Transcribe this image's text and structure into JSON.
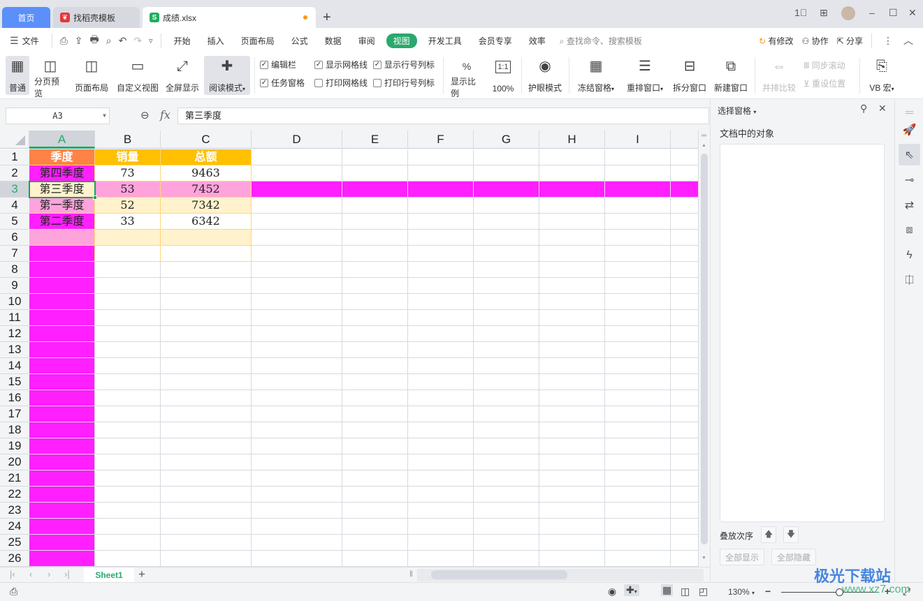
{
  "titlebar": {
    "tabs": [
      {
        "label": "首页",
        "icon": "home"
      },
      {
        "label": "找稻壳模板",
        "icon": "docer-icon"
      },
      {
        "label": "成绩.xlsx",
        "icon": "spreadsheet-icon",
        "icon_glyph": "S",
        "modified": true
      }
    ],
    "add_tab": "+",
    "window_buttons": {
      "layout": "1⃞",
      "apps": "⊞",
      "minimize": "–",
      "maximize": "☐",
      "close": "✕"
    }
  },
  "menubar": {
    "file_label": "文件",
    "menu_icon": "☰",
    "quick": [
      "⎙",
      "⇪",
      "🖶",
      "⌕",
      "↶",
      "↷",
      "▿"
    ],
    "items": [
      "开始",
      "插入",
      "页面布局",
      "公式",
      "数据",
      "审阅",
      "视图",
      "开发工具",
      "会员专享",
      "效率"
    ],
    "active_item": "视图",
    "search_placeholder": "查找命令、搜索模板",
    "right": {
      "changes": "有修改",
      "collab": "协作",
      "share": "分享"
    }
  },
  "ribbon": {
    "views": [
      {
        "label": "普通",
        "icon": "▦",
        "selected": true
      },
      {
        "label": "分页预览",
        "icon": "◫"
      },
      {
        "label": "页面布局",
        "icon": "◫"
      },
      {
        "label": "自定义视图",
        "icon": "▭"
      },
      {
        "label": "全屏显示",
        "icon": "⤢"
      },
      {
        "label": "阅读模式",
        "icon": "✚",
        "dropdown": true,
        "selected": true
      }
    ],
    "checkboxes": [
      {
        "label": "编辑栏",
        "checked": true
      },
      {
        "label": "显示网格线",
        "checked": true
      },
      {
        "label": "显示行号列标",
        "checked": true
      },
      {
        "label": "任务窗格",
        "checked": true
      },
      {
        "label": "打印网格线",
        "checked": false
      },
      {
        "label": "打印行号列标",
        "checked": false
      }
    ],
    "zoom": [
      {
        "label": "显示比例",
        "icon": "%"
      },
      {
        "label": "100%",
        "icon": "1:1"
      }
    ],
    "eye": {
      "label": "护眼模式",
      "icon": "◉"
    },
    "window": [
      {
        "label": "冻结窗格",
        "icon": "▦",
        "dropdown": true
      },
      {
        "label": "重排窗口",
        "icon": "☰",
        "dropdown": true
      },
      {
        "label": "拆分窗口",
        "icon": "⊟"
      },
      {
        "label": "新建窗口",
        "icon": "⧉"
      }
    ],
    "compare": {
      "label": "并排比较",
      "icon": "⇔",
      "disabled": true
    },
    "sync_scroll": "同步滚动",
    "reset_pos": "重设位置",
    "macro": {
      "label": "VB 宏",
      "icon": "⎘",
      "dropdown": true
    }
  },
  "formula_bar": {
    "name_box": "A3",
    "fx": "fx",
    "content": "第三季度"
  },
  "grid": {
    "columns": [
      "A",
      "B",
      "C",
      "D",
      "E",
      "F",
      "G",
      "H",
      "I"
    ],
    "selected_column": "A",
    "rows": [
      "1",
      "2",
      "3",
      "4",
      "5",
      "6",
      "7",
      "8",
      "9",
      "10",
      "11",
      "12",
      "13",
      "14",
      "15",
      "16",
      "17",
      "18",
      "19",
      "20",
      "21",
      "22",
      "23",
      "24",
      "25",
      "26"
    ],
    "selected_row": "3",
    "cells": [
      [
        "季度",
        "销量",
        "总额"
      ],
      [
        "第四季度",
        "73",
        "9463"
      ],
      [
        "第三季度",
        "53",
        "7452"
      ],
      [
        "第一季度",
        "52",
        "7342"
      ],
      [
        "第二季度",
        "33",
        "6342"
      ]
    ],
    "colors": {
      "header_a": "#ff8247",
      "header_bc": "#ffc000",
      "magenta": "#ff1fff",
      "pink": "#ffa3dc",
      "cream": "#fff2cc",
      "selection": "#1f9e5f"
    }
  },
  "sheets": {
    "tabs": [
      "Sheet1"
    ],
    "active": "Sheet1",
    "add": "+",
    "nav": [
      "|‹",
      "‹",
      "›",
      "›|"
    ]
  },
  "selection_pane": {
    "title": "选择窗格",
    "section": "文档中的对象",
    "order_label": "叠放次序",
    "up": "🡅",
    "down": "🡇",
    "show_all": "全部显示",
    "hide_all": "全部隐藏"
  },
  "status": {
    "zoom": "130%",
    "minus": "−",
    "plus": "+",
    "zoom_slider_fraction": 0.6
  },
  "watermark": {
    "name": "极光下载站",
    "url": "www.xz7.com"
  }
}
